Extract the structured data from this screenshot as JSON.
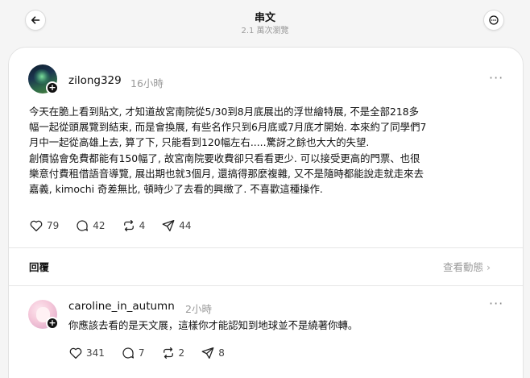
{
  "header": {
    "title": "串文",
    "views": "2.1 萬次瀏覽"
  },
  "post": {
    "username": "zilong329",
    "time": "16小時",
    "lines": [
      "今天在脆上看到貼文, 才知道故宮南院從5/30到8月底展出的浮世繪特展, 不是全部218多",
      "幅一起從頭展覽到結束, 而是會換展, 有些名作只到6月底或7月底才開始. 本來約了同學們7",
      "月中一起從高雄上去, 算了下, 只能看到120幅左右.....驚訝之餘也大大的失望.",
      "創價協會免費都能有150幅了, 故宮南院要收費卻只看看更少. 可以接受更高的門票、也很",
      "樂意付費租借語音導覽, 展出期也就3個月, 還搞得那麼複雜, 又不是隨時都能說走就走來去",
      "嘉義, kimochi 奇差無比, 頓時少了去看的興緻了. 不喜歡這種操作."
    ],
    "likes": "79",
    "comments": "42",
    "reposts": "4",
    "shares": "44"
  },
  "replies_section": {
    "label": "回覆",
    "view_activity": "查看動態"
  },
  "reply": {
    "username": "caroline_in_autumn",
    "time": "2小時",
    "text": "你應該去看的是天文展，這樣你才能認知到地球並不是繞著你轉。",
    "likes": "341",
    "comments": "7",
    "reposts": "2",
    "shares": "8"
  },
  "icons": [
    "back-arrow-icon",
    "more-icon",
    "heart-icon",
    "comment-icon",
    "repost-icon",
    "share-icon",
    "plus-icon",
    "chevron-right-icon"
  ]
}
